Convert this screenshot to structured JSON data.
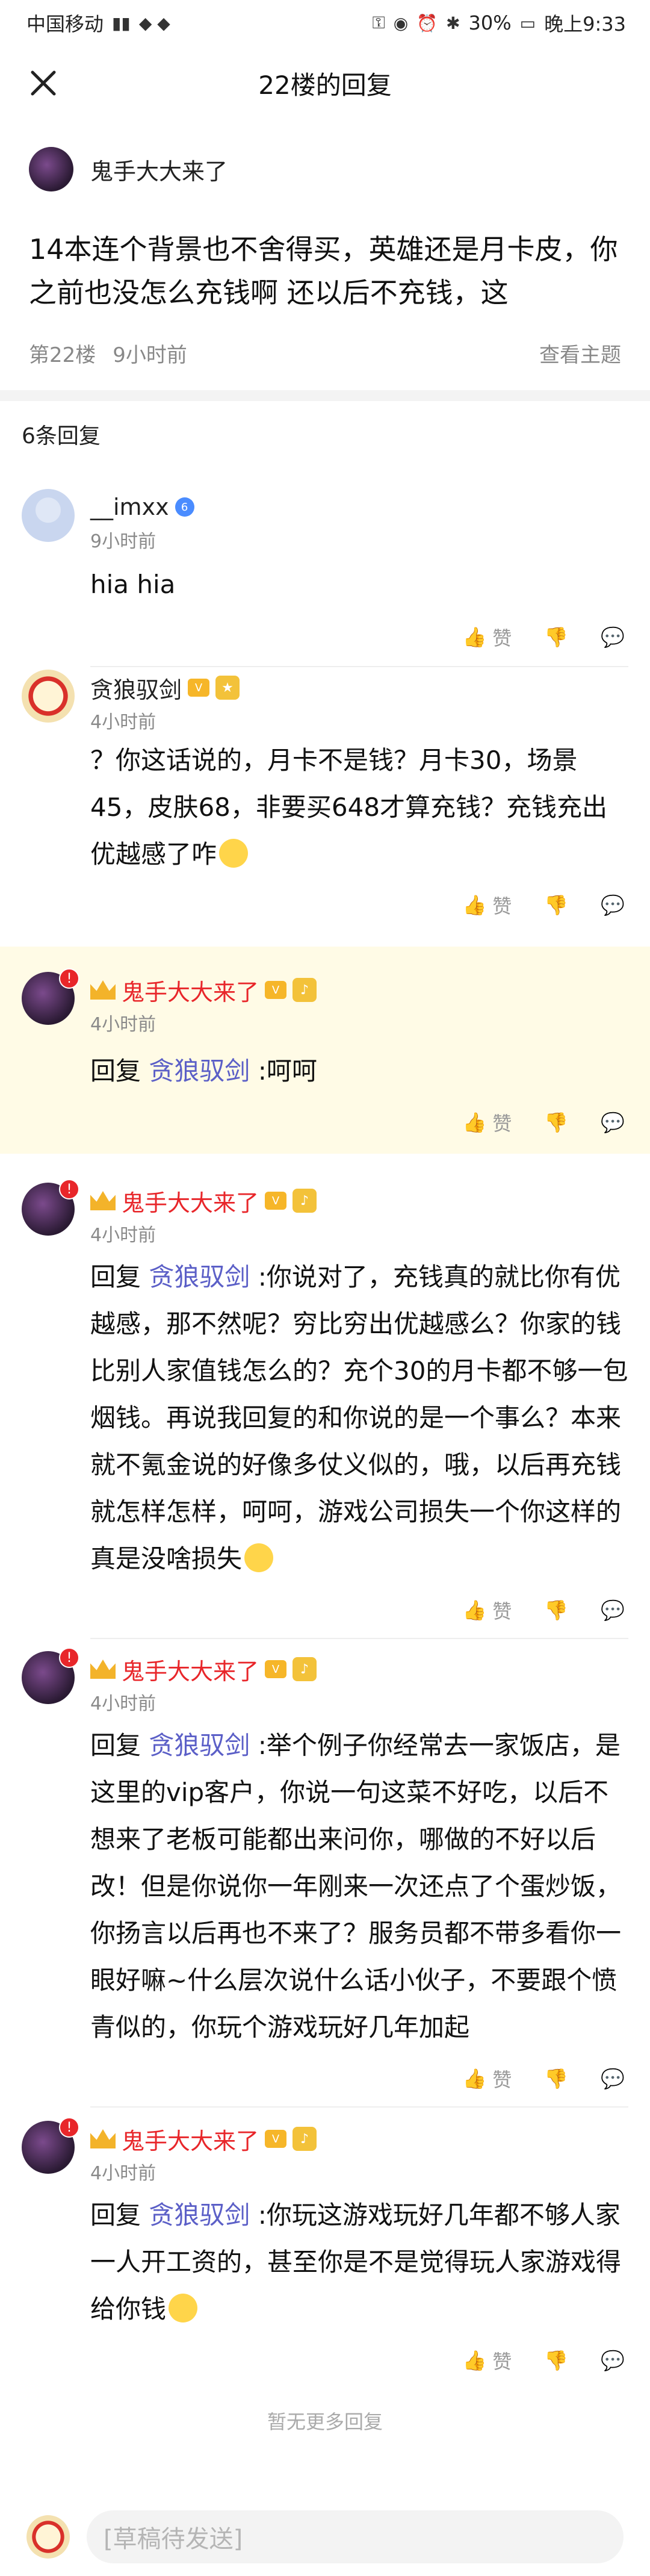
{
  "status_bar": {
    "carrier": "中国移动",
    "battery": "30%",
    "time": "晚上9:33"
  },
  "nav": {
    "title": "22楼的回复"
  },
  "floor": {
    "author": "鬼手大大来了",
    "content": "14本连个背景也不舍得买，英雄还是月卡皮，你之前也没怎么充钱啊  还以后不充钱，这",
    "floor_label": "第22楼",
    "time": "9小时前",
    "view_topic": "查看主题"
  },
  "reply_count": "6条回复",
  "replies": [
    {
      "name": "__imxx",
      "time": "9小时前",
      "prefix": "",
      "link": "",
      "text": "hia hia"
    },
    {
      "name": "贪狼驭剑",
      "time": "4小时前",
      "prefix": "",
      "link": "",
      "text": "？你这话说的，月卡不是钱？月卡30，场景45，皮肤68，非要买648才算充钱？充钱充出优越感了咋"
    },
    {
      "name": "鬼手大大来了",
      "time": "4小时前",
      "prefix": "回复 ",
      "link": "贪狼驭剑",
      "text": " :呵呵"
    },
    {
      "name": "鬼手大大来了",
      "time": "4小时前",
      "prefix": "回复 ",
      "link": "贪狼驭剑",
      "text": " :你说对了，充钱真的就比你有优越感，那不然呢？穷比穷出优越感么？你家的钱比别人家值钱怎么的？充个30的月卡都不够一包烟钱。再说我回复的和你说的是一个事么？本来就不氪金说的好像多仗义似的，哦，以后再充钱就怎样怎样，呵呵，游戏公司损失一个你这样的真是没啥损失"
    },
    {
      "name": "鬼手大大来了",
      "time": "4小时前",
      "prefix": "回复 ",
      "link": "贪狼驭剑",
      "text": " :举个例子你经常去一家饭店，是这里的vip客户，你说一句这菜不好吃，以后不想来了老板可能都出来问你，哪做的不好以后改！但是你说你一年刚来一次还点了个蛋炒饭，你扬言以后再也不来了？服务员都不带多看你一眼好嘛~什么层次说什么话小伙子，不要跟个愤青似的，你玩个游戏玩好几年加起"
    },
    {
      "name": "鬼手大大来了",
      "time": "4小时前",
      "prefix": "回复 ",
      "link": "贪狼驭剑",
      "text": " :你玩这游戏玩好几年都不够人家一人开工资的，甚至你是不是觉得玩人家游戏得给你钱"
    }
  ],
  "like_label": "赞",
  "no_more": "暂无更多回复",
  "input_placeholder": "[草稿待发送]",
  "colors": {
    "vip_name": "#e8262a",
    "link": "#5b5fc7",
    "highlight_bg": "#fffbe6"
  }
}
